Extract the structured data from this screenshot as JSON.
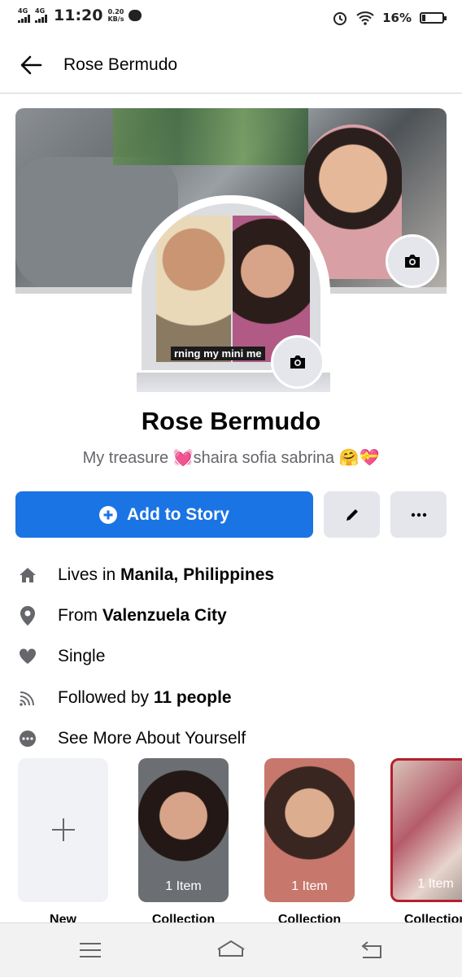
{
  "status_bar": {
    "network_1": "4G",
    "network_2": "4G",
    "time": "11:20",
    "speed_value": "0.20",
    "speed_unit": "KB/s",
    "battery": "16%"
  },
  "header": {
    "title": "Rose Bermudo"
  },
  "profile": {
    "name": "Rose Bermudo",
    "bio": "My treasure 💓shaira sofia sabrina 🤗💝",
    "photo_caption": "rning my mini me"
  },
  "actions": {
    "add_story_label": "Add to Story"
  },
  "details": {
    "lives_prefix": "Lives in ",
    "lives_value": "Manila, Philippines",
    "from_prefix": "From ",
    "from_value": "Valenzuela City",
    "relationship": "Single",
    "followed_prefix": "Followed by ",
    "followed_value": "11 people",
    "see_more": "See More About Yourself"
  },
  "collections": [
    {
      "label": "New",
      "count": ""
    },
    {
      "label": "Collection",
      "count": "1 Item"
    },
    {
      "label": "Collection",
      "count": "1 Item"
    },
    {
      "label": "Collection",
      "count": "1 Item"
    }
  ],
  "icons": {
    "back": "arrow-left-icon",
    "camera": "camera-icon",
    "edit": "pencil-icon",
    "more": "more-horizontal-icon",
    "home": "home-icon",
    "location": "location-pin-icon",
    "heart": "heart-icon",
    "rss": "rss-icon",
    "dots": "dots-circle-icon"
  },
  "colors": {
    "accent": "#1b74e4",
    "secondary_text": "#65676b",
    "button_gray": "#e4e6eb"
  }
}
